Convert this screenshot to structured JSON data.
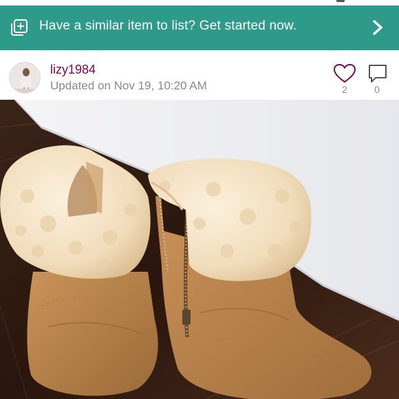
{
  "banner": {
    "text": "Have a similar item to list? Get started now.",
    "icon": "add-listing-icon",
    "chevron_icon": "chevron-right-icon",
    "color": "#2e9b8a"
  },
  "post": {
    "username": "lizy1984",
    "updated": "Updated on Nov 19, 10:20 AM",
    "likes": "2",
    "comments": "0",
    "username_color": "#7f0353"
  },
  "photo": {
    "subject": "two tan suede sheepskin-cuffed boots on a wood floor"
  }
}
